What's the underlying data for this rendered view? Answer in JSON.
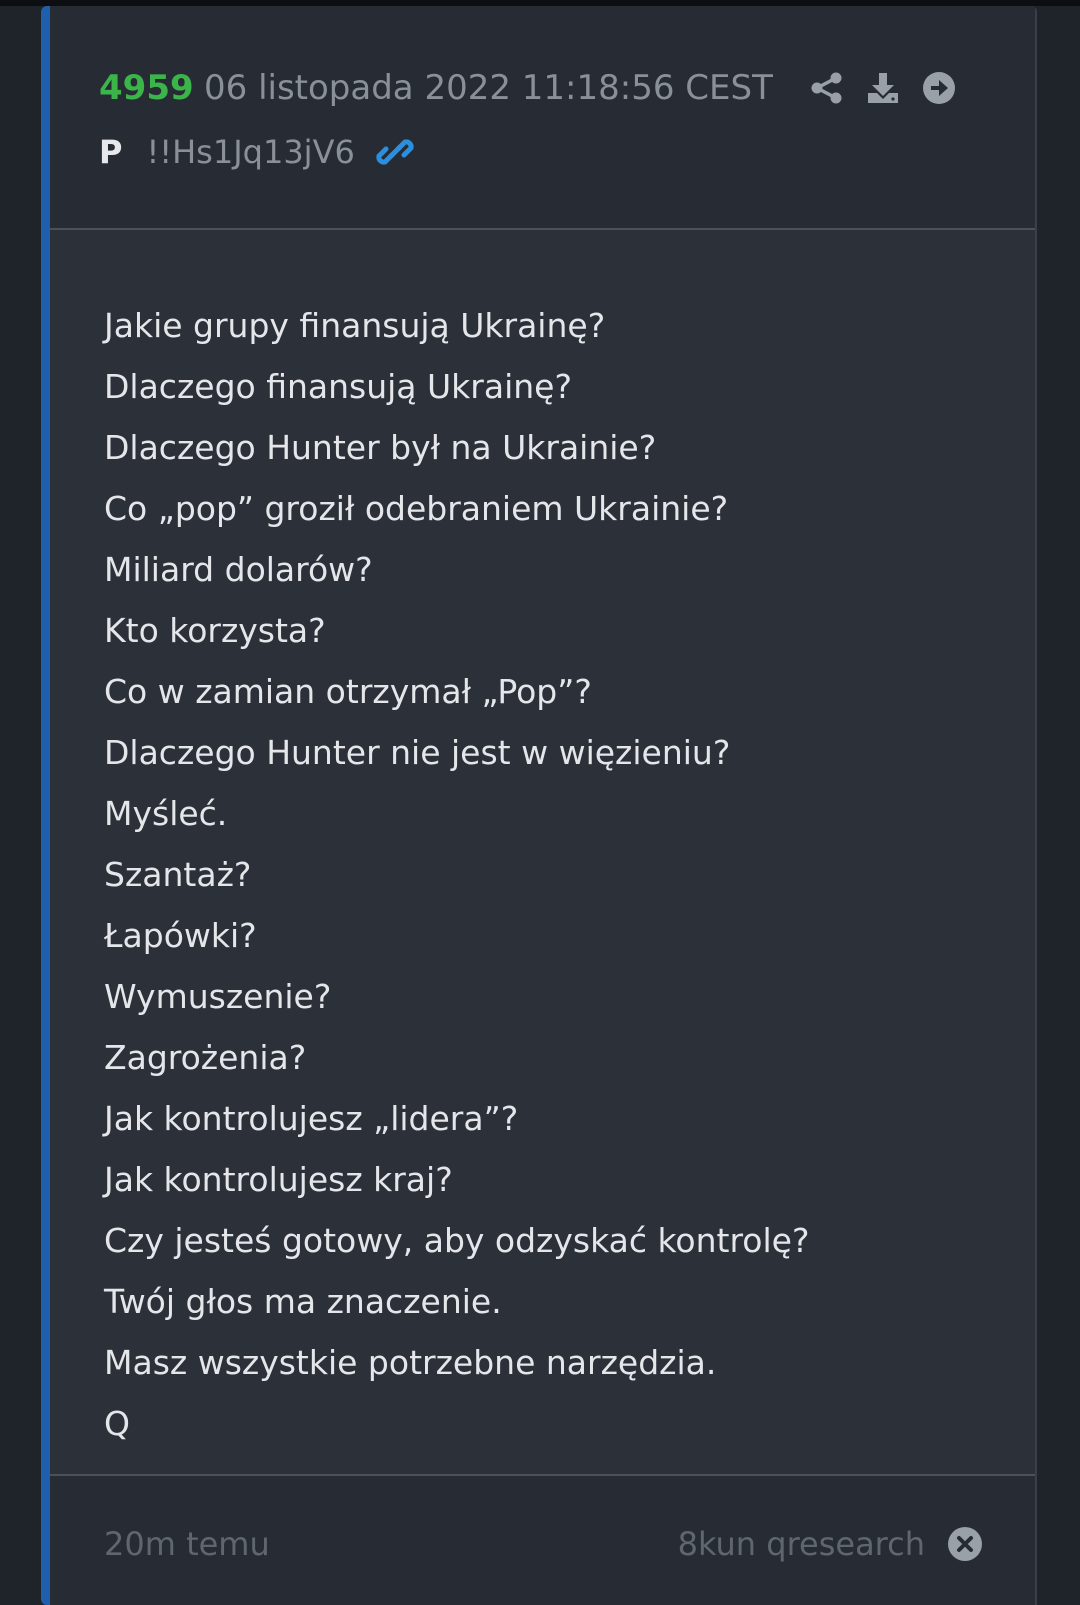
{
  "post": {
    "number": "4959",
    "date": "06 listopada 2022 11:18:56 CEST",
    "author": "P",
    "tripcode": "!!Hs1Jq13jV6",
    "lines": [
      "Jakie grupy finansują Ukrainę?",
      "Dlaczego finansują Ukrainę?",
      "Dlaczego Hunter był na Ukrainie?",
      "Co „pop” groził odebraniem Ukrainie?",
      "Miliard dolarów?",
      "Kto korzysta?",
      "Co w zamian otrzymał „Pop”?",
      "Dlaczego Hunter nie jest w więzieniu?",
      "Myśleć.",
      "Szantaż?",
      "Łapówki?",
      "Wymuszenie?",
      "Zagrożenia?",
      "Jak kontrolujesz „lidera”?",
      "Jak kontrolujesz kraj?",
      "Czy jesteś gotowy, aby odzyskać kontrolę?",
      "Twój głos ma znaczenie.",
      "Masz wszystkie potrzebne narzędzia.",
      "Q"
    ]
  },
  "footer": {
    "time_ago": "20m temu",
    "source": "8kun qresearch"
  },
  "icons": {
    "share": "share-icon",
    "download": "download-icon",
    "open": "arrow-circle-right-icon",
    "link": "link-icon",
    "close": "close-circle-icon"
  },
  "colors": {
    "background": "#1f232a",
    "card": "#2b3039",
    "accent_border": "#1e5fae",
    "post_number": "#3bb54a",
    "muted_text": "#8a9099",
    "body_text": "#e4e6e9",
    "link": "#2a8fe0"
  }
}
